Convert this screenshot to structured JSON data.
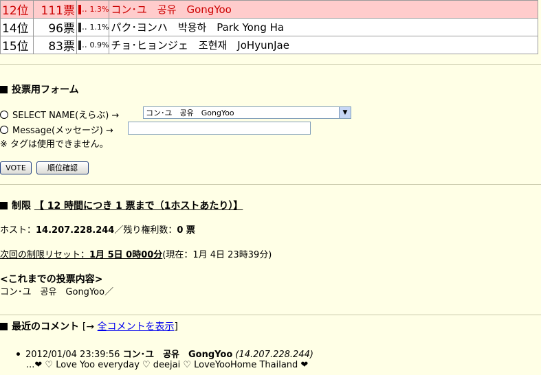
{
  "ranking": [
    {
      "rank": "12位",
      "votes": "111票",
      "percent": "1.3%",
      "name": "コン･ユ　공유　GongYoo",
      "highlight": true
    },
    {
      "rank": "14位",
      "votes": "96票",
      "percent": "1.1%",
      "name": "パク･ヨンハ　박용하　Park Yong Ha",
      "highlight": false
    },
    {
      "rank": "15位",
      "votes": "83票",
      "percent": "0.9%",
      "name": "チョ･ヒョンジェ　조현재　JoHyunJae",
      "highlight": false
    }
  ],
  "form": {
    "heading": "投票用フォーム",
    "select_label": "SELECT NAME(えらぶ) →",
    "select_value": "コン･ユ　공유　GongYoo",
    "message_label": "Message(メッセージ) →",
    "message_value": "",
    "tag_note": "※ タグは使用できません。",
    "vote_button": "VOTE",
    "rank_button": "順位確認"
  },
  "limit": {
    "heading": "制限",
    "rule": "【 12 時間につき 1 票まで（1ホストあたり）】",
    "host_label": "ホスト：",
    "host_ip": "14.207.228.244",
    "remaining_label": "／残り権利数：",
    "remaining_value": "0 票",
    "reset_label": "次回の制限リセット：",
    "reset_value": "1月 5日 0時00分",
    "current": "(現在：1月 4日 23時39分)",
    "history_heading": "<これまでの投票内容>",
    "history_value": "コン･ユ　공유　GongYoo／"
  },
  "comments": {
    "heading": "最近のコメント",
    "link_prefix": "[→ ",
    "link_text": "全コメントを表示",
    "link_suffix": "]",
    "items": [
      {
        "datetime": "2012/01/04 23:39:56",
        "name": "コン･ユ　공유　GongYoo",
        "ip": "(14.207.228.244)",
        "text": "...❤ ♡ Love Yoo everyday ♡ deejai ♡ LoveYooHome Thailand ❤"
      }
    ]
  },
  "colors": {
    "highlight_bg": "#ffcccc",
    "highlight_text": "#cc0000",
    "page_bg": "#ffffe6",
    "link": "#0000ee"
  }
}
